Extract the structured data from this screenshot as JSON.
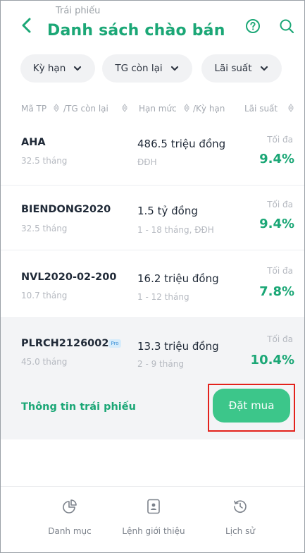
{
  "header": {
    "supertitle": "Trái phiếu",
    "title": "Danh sách chào bán",
    "back_icon": "chevron-left-icon",
    "help_icon": "help-circle-icon",
    "search_icon": "search-icon"
  },
  "filters": [
    {
      "label": "Kỳ hạn"
    },
    {
      "label": "TG còn lại"
    },
    {
      "label": "Lãi suất"
    }
  ],
  "columns": {
    "code": "Mã TP",
    "remaining": "/TG còn lại",
    "limit": "Hạn mức",
    "term": "/Kỳ hạn",
    "rate": "Lãi suất"
  },
  "bonds": [
    {
      "code": "AHA",
      "remaining": "32.5 tháng",
      "limit": "486.5 triệu đồng",
      "term": "ĐĐH",
      "max_label": "Tối đa",
      "rate": "9.4%"
    },
    {
      "code": "BIENDONG2020",
      "remaining": "32.5 tháng",
      "limit": "1.5 tỷ đồng",
      "term": "1 - 18 tháng, ĐĐH",
      "max_label": "Tối đa",
      "rate": "9.4%"
    },
    {
      "code": "NVL2020-02-200",
      "remaining": "10.7 tháng",
      "limit": "16.2 triệu đồng",
      "term": "1 - 12 tháng",
      "max_label": "Tối đa",
      "rate": "7.8%"
    },
    {
      "code": "PLRCH2126002",
      "badge": "Pro",
      "remaining": "45.0 tháng",
      "limit": "13.3 triệu đồng",
      "term": "2 - 9 tháng",
      "max_label": "Tối đa",
      "rate": "10.4%"
    }
  ],
  "selected_actions": {
    "info_link": "Thông tin trái phiếu",
    "buy_button": "Đặt mua"
  },
  "bottom_nav": [
    {
      "label": "Danh mục",
      "icon": "pie-chart-icon"
    },
    {
      "label": "Lệnh giới thiệu",
      "icon": "document-user-icon"
    },
    {
      "label": "Lịch sử",
      "icon": "history-icon"
    }
  ],
  "colors": {
    "brand_green": "#1ba776",
    "button_green": "#3cc68a",
    "highlight_outline": "#e3221c"
  }
}
